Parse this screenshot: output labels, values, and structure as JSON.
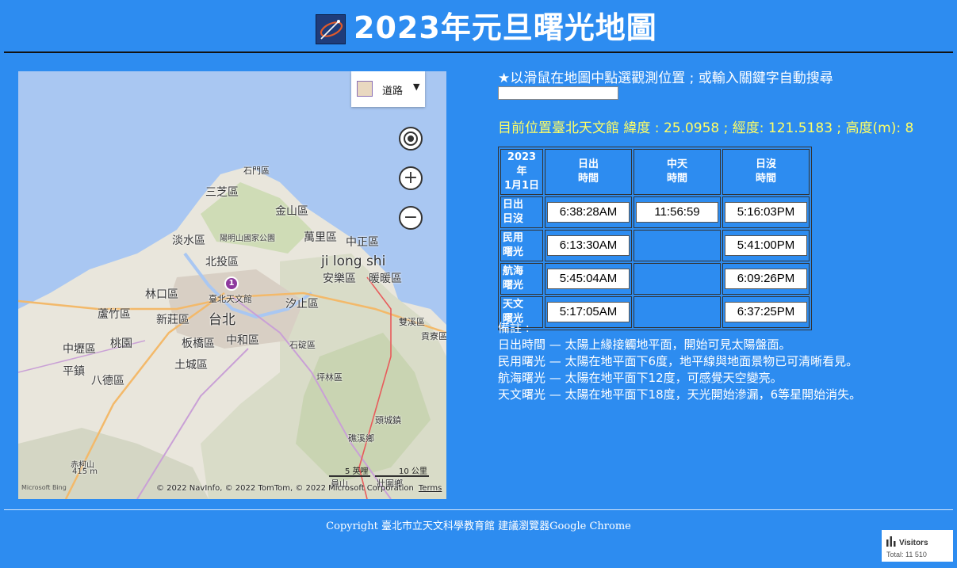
{
  "header": {
    "title": "2023年元旦曙光地圖"
  },
  "map": {
    "type_label": "道路",
    "pin_label": "1",
    "scale_mi": "5 英哩",
    "scale_km": "10 公里",
    "copyright": "© 2022 NavInfo, © 2022 TomTom, © 2022 Microsoft Corporation",
    "terms": "Terms",
    "bing": "Microsoft Bing",
    "places": {
      "shimen": "石門區",
      "sanzhi": "三芝區",
      "jinshan": "金山區",
      "tamsui": "淡水區",
      "yangming": "陽明山國家公園",
      "wanli": "萬里區",
      "zhongzheng": "中正區",
      "beitou": "北投區",
      "jilong": "ji long shi",
      "anle": "安樂區",
      "nuannuan": "暖暖區",
      "linkou": "林口區",
      "tianwen": "臺北天文館",
      "xizhi": "汐止區",
      "luzhu": "蘆竹區",
      "xinzhuang": "新莊區",
      "taipei": "台北",
      "shuangxi": "雙溪區",
      "gongliao": "貢寮區",
      "zhongli": "中壢區",
      "taoyuan": "桃園",
      "banqiao": "板橋區",
      "zhonghe": "中和區",
      "shiding": "石碇區",
      "pingzhen": "平鎮",
      "bade": "八德區",
      "tucheng": "土城區",
      "pinglin": "坪林區",
      "toucheng": "頭城鎮",
      "jiaoxi": "礁溪鄉",
      "chihshan": "赤柯山",
      "elev": "415 m",
      "yuanshan": "員山",
      "zhuangwei": "壯圍鄉"
    }
  },
  "instructions": "★以滑鼠在地圖中點選觀測位置 ; 或輸入關鍵字自動搜尋",
  "search": {
    "value": "",
    "placeholder": ""
  },
  "location_text": "目前位置臺北天文館 緯度 : 25.0958 ; 經度: 121.5183 ; 高度(m): 8",
  "table": {
    "corner": [
      "2023年",
      "1月1日"
    ],
    "columns": [
      [
        "日出",
        "時間"
      ],
      [
        "中天",
        "時間"
      ],
      [
        "日沒",
        "時間"
      ]
    ],
    "rows": [
      {
        "label": [
          "日出",
          "日沒"
        ],
        "rise": "6:38:28AM",
        "noon": "11:56:59",
        "set": "5:16:03PM"
      },
      {
        "label": [
          "民用",
          "曙光"
        ],
        "rise": "6:13:30AM",
        "noon": "",
        "set": "5:41:00PM"
      },
      {
        "label": [
          "航海",
          "曙光"
        ],
        "rise": "5:45:04AM",
        "noon": "",
        "set": "6:09:26PM"
      },
      {
        "label": [
          "天文",
          "曙光"
        ],
        "rise": "5:17:05AM",
        "noon": "",
        "set": "6:37:25PM"
      }
    ]
  },
  "notes": {
    "title": "備註 :",
    "items": [
      "日出時間 — 太陽上緣接觸地平面，開始可見太陽盤面。",
      "民用曙光 — 太陽在地平面下6度，地平線與地面景物已可清晰看見。",
      "航海曙光 — 太陽在地平面下12度，可感覺天空變亮。",
      "天文曙光 — 太陽在地平面下18度，天光開始滲漏，6等星開始消失。"
    ]
  },
  "footer": {
    "text": "Copyright 臺北市立天文科學教育館 建議瀏覽器Google Chrome",
    "visitors_label": "Visitors",
    "visitors_total": "Total: 11 510"
  },
  "colors": {
    "background": "#2d8cf0",
    "location_text": "#ffff66",
    "pin": "#8e3a9e"
  }
}
